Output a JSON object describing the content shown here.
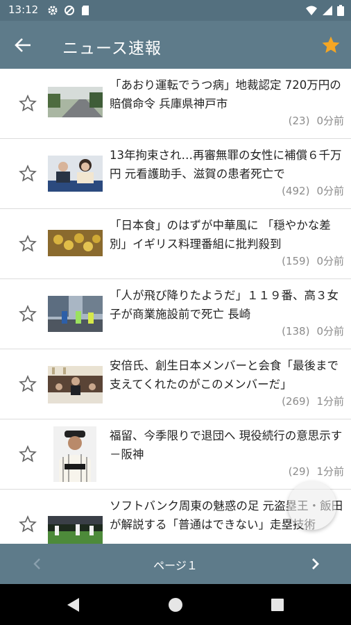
{
  "status_bar": {
    "time": "13:12"
  },
  "app_bar": {
    "title": "ニュース速報"
  },
  "articles": [
    {
      "headline": "「あおり運転でうつ病」地裁認定 720万円の賠償命令 兵庫県神戸市",
      "count": "(23)",
      "time": "0分前"
    },
    {
      "headline": "13年拘束され…再審無罪の女性に補償６千万円 元看護助手、滋賀の患者死亡で",
      "count": "(492)",
      "time": "0分前"
    },
    {
      "headline": "「日本食」のはずが中華風に 「穏やかな差別」イギリス料理番組に批判殺到",
      "count": "(159)",
      "time": "0分前"
    },
    {
      "headline": "「人が飛び降りたようだ」１１９番、高３女子が商業施設前で死亡 長崎",
      "count": "(138)",
      "time": "0分前"
    },
    {
      "headline": "安倍氏、創生日本メンバーと会食「最後まで支えてくれたのがこのメンバーだ」",
      "count": "(269)",
      "time": "1分前"
    },
    {
      "headline": "福留、今季限りで退団へ 現役続行の意思示す－阪神",
      "count": "(29)",
      "time": "1分前"
    },
    {
      "headline": "ソフトバンク周東の魅惑の足 元盗塁王・飯田が解説する「普通はできない」走塁技術",
      "count": "",
      "time": ""
    }
  ],
  "pager": {
    "label": "ページ１"
  },
  "colors": {
    "app_bar": "#5e7b8a",
    "status_bar": "#54707f",
    "favorite_star": "#f5a623"
  }
}
